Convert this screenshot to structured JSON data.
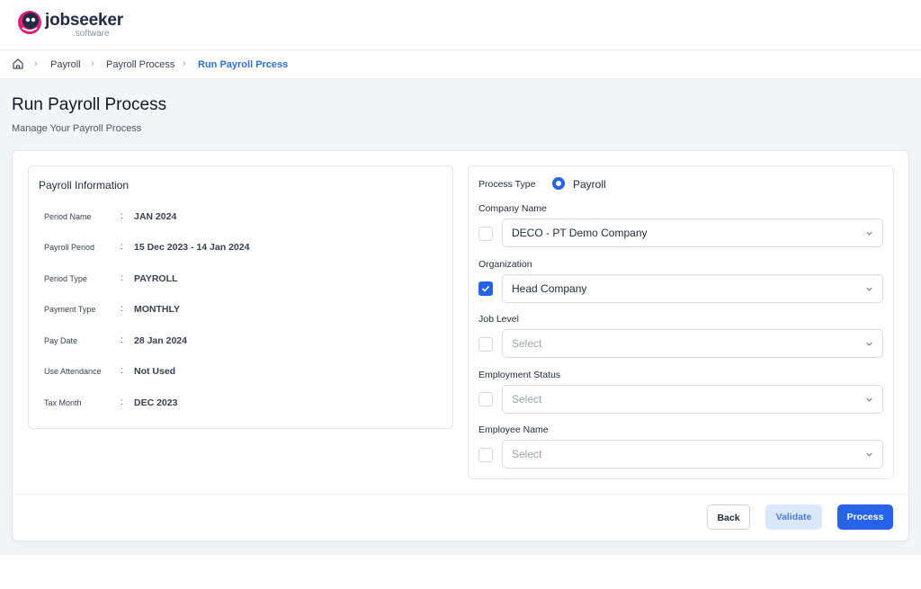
{
  "brand": {
    "name": "jobseeker",
    "sub": ".software",
    "color": "#e11d74"
  },
  "breadcrumb": {
    "items": [
      "Payroll",
      "Payroll Process"
    ],
    "current": "Run Payroll Prcess"
  },
  "page": {
    "title": "Run Payroll Process",
    "subtitle": "Manage Your Payroll Process"
  },
  "info": {
    "title": "Payroll Information",
    "rows": [
      {
        "label": "Period Name",
        "value": "JAN 2024"
      },
      {
        "label": "Payroll Period",
        "value": "15 Dec 2023 - 14 Jan 2024"
      },
      {
        "label": "Period Type",
        "value": "PAYROLL"
      },
      {
        "label": "Payment Type",
        "value": "MONTHLY"
      },
      {
        "label": "Pay Date",
        "value": "28 Jan 2024"
      },
      {
        "label": "Use Attendance",
        "value": "Not Used"
      },
      {
        "label": "Tax Month",
        "value": "DEC 2023"
      }
    ]
  },
  "filters": {
    "process_type_label": "Process Type",
    "process_type_value": "Payroll",
    "fields": [
      {
        "label": "Company Name",
        "value": "DECO - PT Demo Company",
        "checked": false
      },
      {
        "label": "Organization",
        "value": "Head Company",
        "checked": true
      },
      {
        "label": "Job Level",
        "placeholder": "Select",
        "checked": false
      },
      {
        "label": "Employment Status",
        "placeholder": "Select",
        "checked": false
      },
      {
        "label": "Employee Name",
        "placeholder": "Select",
        "checked": false
      }
    ]
  },
  "actions": {
    "back": "Back",
    "validate": "Validate",
    "process": "Process"
  },
  "colors": {
    "accent": "#2563eb",
    "active_breadcrumb": "#2f6fe0"
  }
}
